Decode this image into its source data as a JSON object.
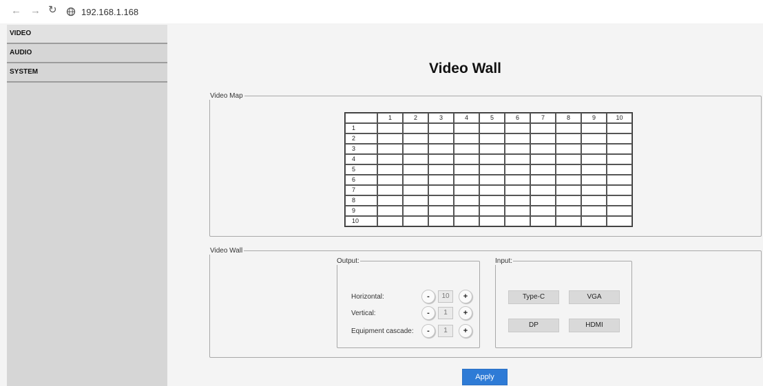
{
  "browser": {
    "url": "192.168.1.168"
  },
  "sidebar": {
    "items": [
      {
        "label": "VIDEO"
      },
      {
        "label": "AUDIO"
      },
      {
        "label": "SYSTEM"
      }
    ]
  },
  "page": {
    "title": "Video Wall"
  },
  "video_map": {
    "legend": "Video Map",
    "columns": [
      "1",
      "2",
      "3",
      "4",
      "5",
      "6",
      "7",
      "8",
      "9",
      "10"
    ],
    "rows": [
      "1",
      "2",
      "3",
      "4",
      "5",
      "6",
      "7",
      "8",
      "9",
      "10"
    ]
  },
  "video_wall": {
    "legend": "Video Wall",
    "output": {
      "legend": "Output:",
      "horizontal": {
        "label": "Horizontal:",
        "value": "10"
      },
      "vertical": {
        "label": "Vertical:",
        "value": "1"
      },
      "cascade": {
        "label": "Equipment cascade:",
        "value": "1"
      },
      "minus": "-",
      "plus": "+"
    },
    "input": {
      "legend": "Input:",
      "buttons": [
        "Type-C",
        "VGA",
        "DP",
        "HDMI"
      ]
    }
  },
  "apply_label": "Apply",
  "colors": {
    "apply": "#2e7bd6",
    "sidebar": "#d6d6d6"
  }
}
